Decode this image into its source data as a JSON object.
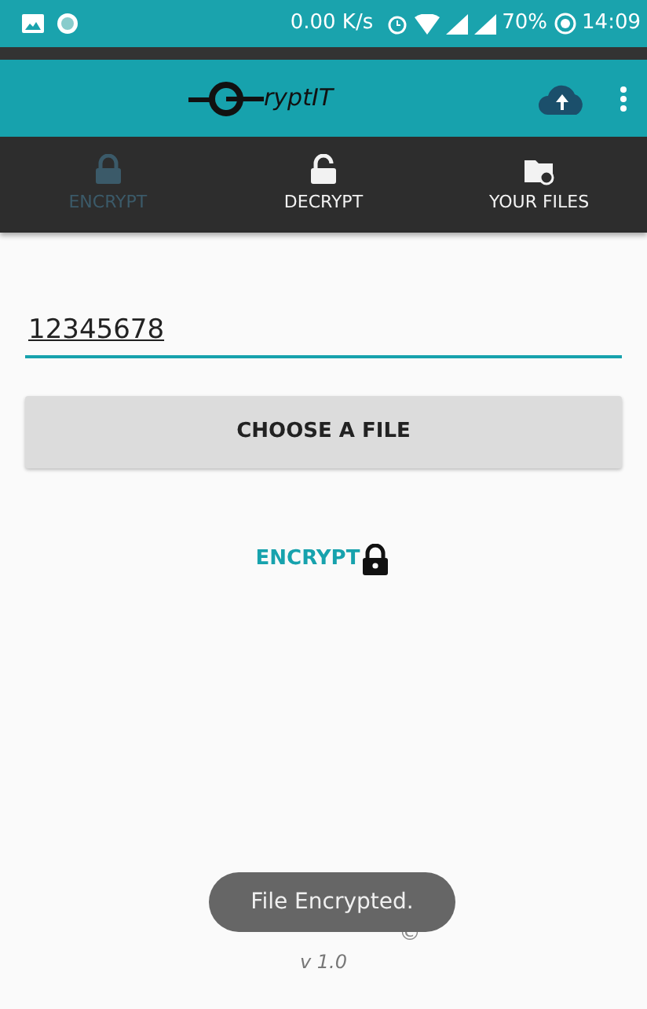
{
  "status_bar": {
    "speed": "0.00 K/s",
    "battery": "70%",
    "time": "14:09"
  },
  "app_bar": {
    "logo_text": "ryptIT"
  },
  "tabs": [
    {
      "label": "ENCRYPT",
      "selected": true,
      "kind": "lock"
    },
    {
      "label": "DECRYPT",
      "selected": false,
      "kind": "unlock"
    },
    {
      "label": "YOUR FILES",
      "selected": false,
      "kind": "folder"
    }
  ],
  "password_field": {
    "value": "12345678"
  },
  "choose_button": {
    "label": "CHOOSE A FILE"
  },
  "encrypt_link": {
    "label": "ENCRYPT"
  },
  "footer": {
    "name": "©",
    "version": "v 1.0"
  },
  "toast": {
    "text": "File Encrypted."
  }
}
